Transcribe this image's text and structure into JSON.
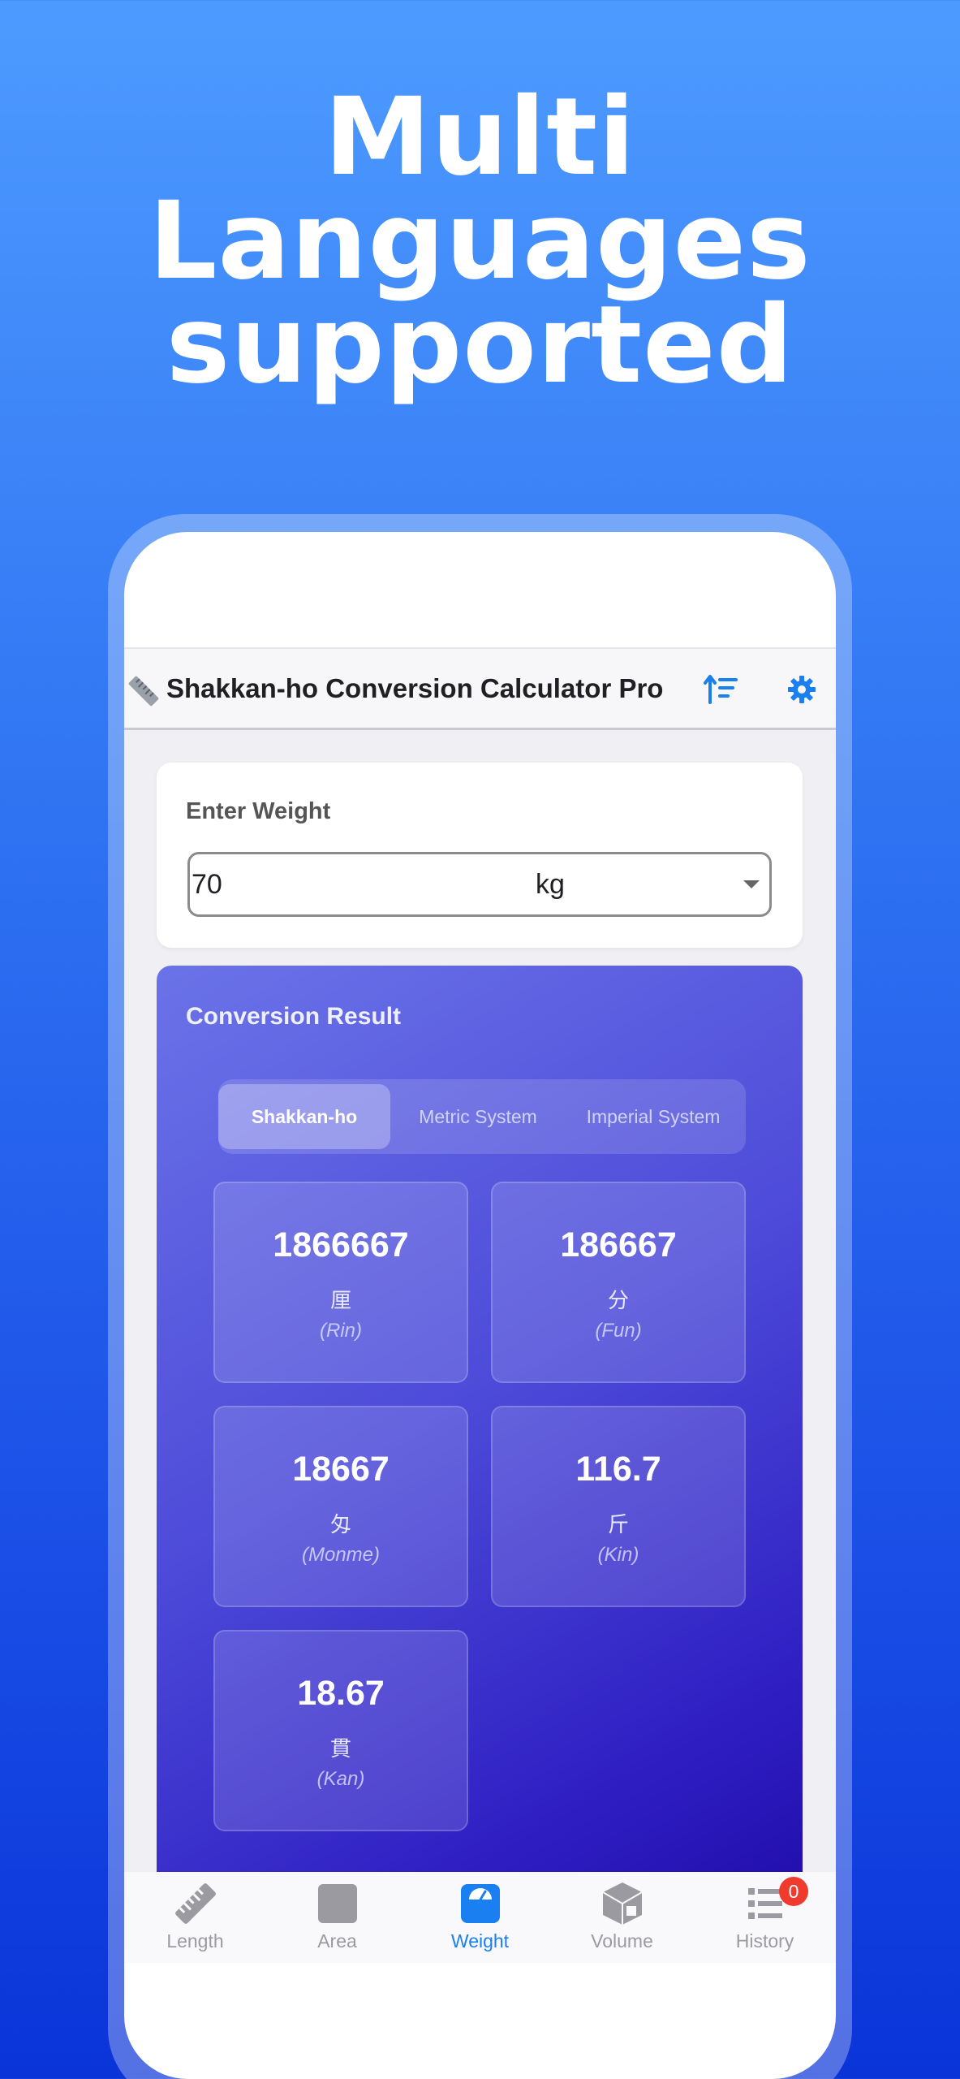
{
  "headline": {
    "line1": "Multi",
    "line2": "Languages",
    "line3": "supported"
  },
  "appbar": {
    "title": "Shakkan-ho Conversion Calculator Pro",
    "ruler_icon": "ruler-icon",
    "sort_icon": "sort-icon",
    "settings_icon": "gear-icon",
    "accent_color": "#1a7ff0"
  },
  "input": {
    "label": "Enter Weight",
    "value": "70",
    "unit": "kg"
  },
  "result": {
    "title": "Conversion Result",
    "tabs": [
      {
        "label": "Shakkan-ho",
        "active": true
      },
      {
        "label": "Metric System",
        "active": false
      },
      {
        "label": "Imperial System",
        "active": false
      }
    ],
    "tiles": [
      {
        "value": "1866667",
        "kanji": "厘",
        "roman": "(Rin)"
      },
      {
        "value": "186667",
        "kanji": "分",
        "roman": "(Fun)"
      },
      {
        "value": "18667",
        "kanji": "匁",
        "roman": "(Monme)"
      },
      {
        "value": "116.7",
        "kanji": "斤",
        "roman": "(Kin)"
      },
      {
        "value": "18.67",
        "kanji": "貫",
        "roman": "(Kan)"
      }
    ]
  },
  "nav": {
    "items": [
      {
        "label": "Length",
        "icon": "ruler-icon",
        "active": false
      },
      {
        "label": "Area",
        "icon": "square-icon",
        "active": false
      },
      {
        "label": "Weight",
        "icon": "scale-icon",
        "active": true
      },
      {
        "label": "Volume",
        "icon": "cube-icon",
        "active": false
      },
      {
        "label": "History",
        "icon": "list-icon",
        "active": false,
        "badge": "0"
      }
    ]
  }
}
